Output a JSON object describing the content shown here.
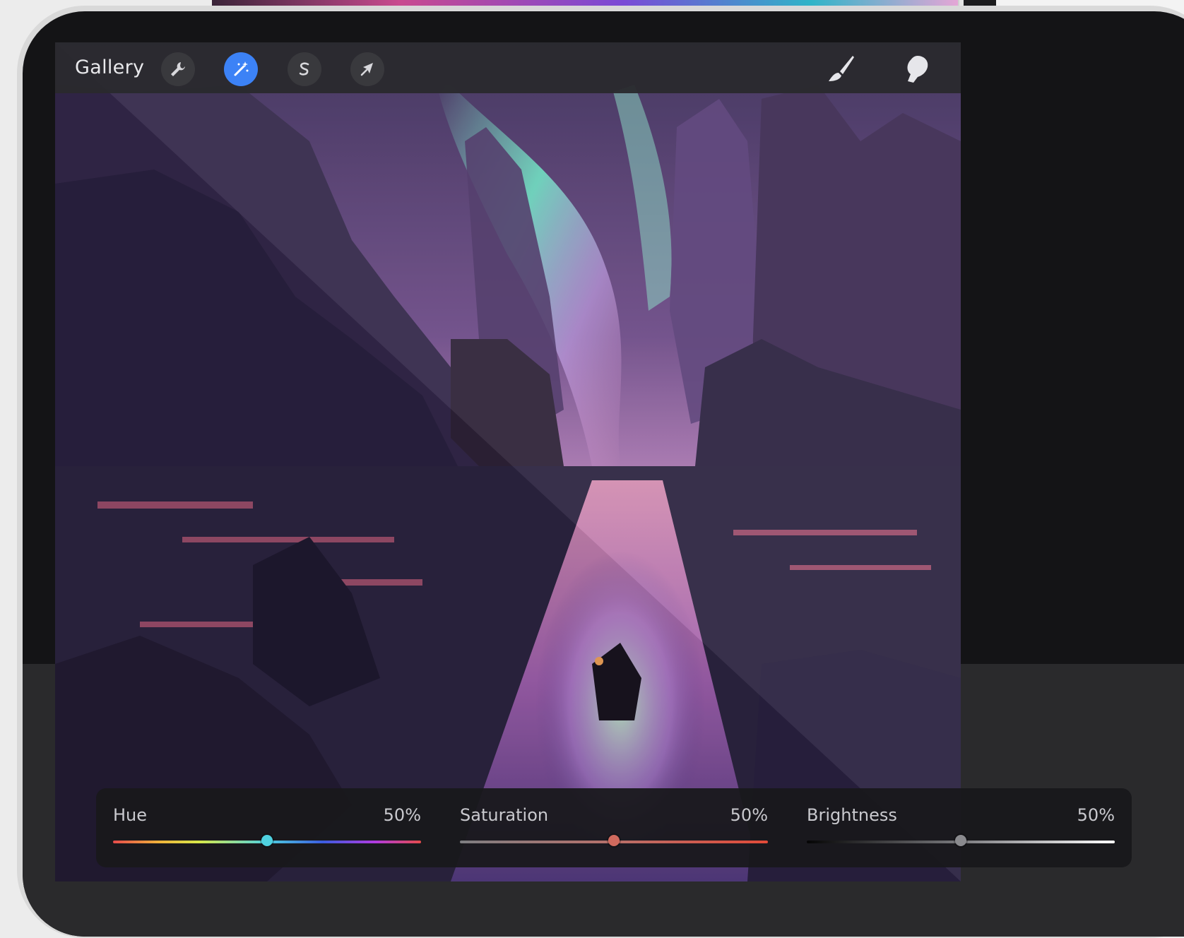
{
  "toolbar": {
    "gallery_label": "Gallery",
    "tools": [
      {
        "name": "actions",
        "icon": "wrench-icon",
        "active": false
      },
      {
        "name": "adjustments",
        "icon": "magic-wand-icon",
        "active": true
      },
      {
        "name": "selection",
        "icon": "selection-s-icon",
        "active": false
      },
      {
        "name": "transform",
        "icon": "arrow-cursor-icon",
        "active": false
      }
    ],
    "right_tools": [
      {
        "name": "brush",
        "icon": "paintbrush-icon"
      },
      {
        "name": "smudge",
        "icon": "smudge-finger-icon"
      }
    ],
    "accent_color": "#3c82f6"
  },
  "adjustments": {
    "sliders": [
      {
        "label": "Hue",
        "value_text": "50%",
        "value": 0.5,
        "thumb_color": "#4fd1e0"
      },
      {
        "label": "Saturation",
        "value_text": "50%",
        "value": 0.5,
        "thumb_color": "#d06a5e"
      },
      {
        "label": "Brightness",
        "value_text": "50%",
        "value": 0.5,
        "thumb_color": "#8a8a8e"
      }
    ]
  },
  "side_panel": {
    "icons": [
      "square-icon",
      "undo-icon",
      "redo-icon"
    ]
  }
}
